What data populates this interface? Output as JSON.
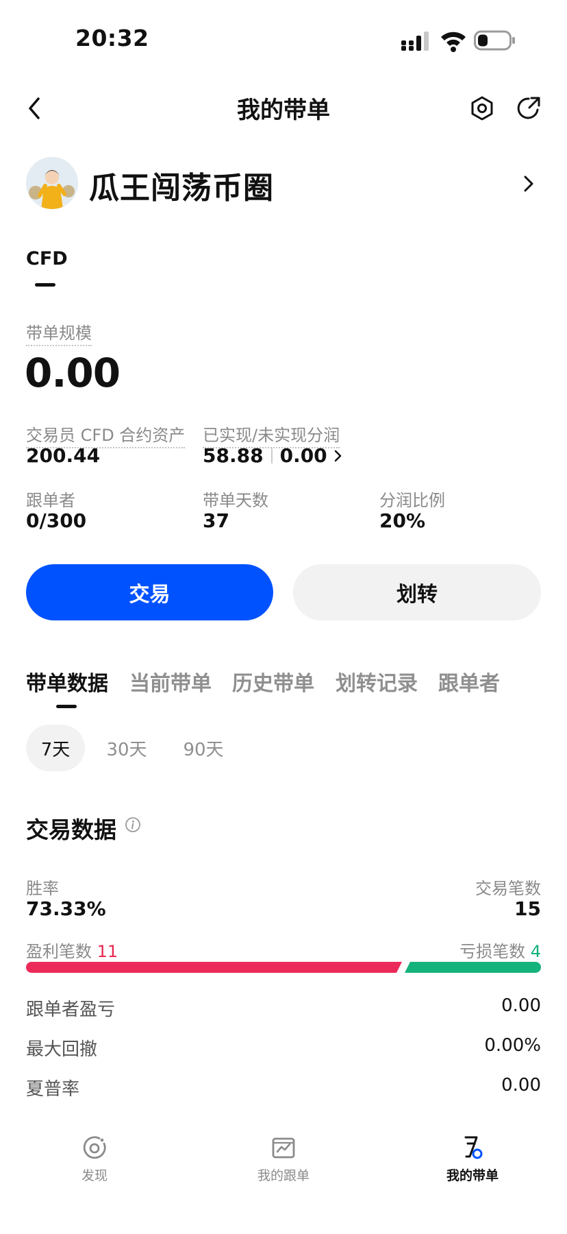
{
  "status_bar": {
    "time": "20:32"
  },
  "header": {
    "title": "我的带单"
  },
  "profile": {
    "name": "瓜王闯荡币圈"
  },
  "top_tabs": [
    {
      "label": "CFD",
      "active": true
    }
  ],
  "scale": {
    "label": "带单规模",
    "value": "0.00"
  },
  "stats": {
    "assets": {
      "label": "交易员 CFD 合约资产",
      "value": "200.44"
    },
    "profit_share": {
      "label": "已实现/未实现分润",
      "realized": "58.88",
      "unrealized": "0.00"
    },
    "followers": {
      "label": "跟单者",
      "value": "0/300"
    },
    "days": {
      "label": "带单天数",
      "value": "37"
    },
    "ratio": {
      "label": "分润比例",
      "value": "20%"
    }
  },
  "buttons": {
    "trade": "交易",
    "transfer": "划转"
  },
  "section_tabs": [
    {
      "label": "带单数据",
      "active": true
    },
    {
      "label": "当前带单",
      "active": false
    },
    {
      "label": "历史带单",
      "active": false
    },
    {
      "label": "划转记录",
      "active": false
    },
    {
      "label": "跟单者",
      "active": false
    }
  ],
  "periods": [
    {
      "label": "7天",
      "active": true
    },
    {
      "label": "30天",
      "active": false
    },
    {
      "label": "90天",
      "active": false
    }
  ],
  "trade_data": {
    "title": "交易数据",
    "win_rate_label": "胜率",
    "win_rate": "73.33%",
    "trade_count_label": "交易笔数",
    "trade_count": "15",
    "profit_count_label": "盈利笔数",
    "profit_count": "11",
    "loss_count_label": "亏损笔数",
    "loss_count": "4",
    "profit_fraction": 0.7333,
    "colors": {
      "profit": "#ec2a59",
      "loss": "#16b27c"
    },
    "metrics": [
      {
        "label": "跟单者盈亏",
        "value": "0.00"
      },
      {
        "label": "最大回撤",
        "value": "0.00%"
      },
      {
        "label": "夏普率",
        "value": "0.00"
      }
    ]
  },
  "bottom_nav": [
    {
      "label": "发现",
      "icon": "discover-icon",
      "active": false
    },
    {
      "label": "我的跟单",
      "icon": "copy-trades-icon",
      "active": false
    },
    {
      "label": "我的带单",
      "icon": "lead-trades-icon",
      "active": true
    }
  ],
  "colors": {
    "accent": "#0052ff"
  }
}
